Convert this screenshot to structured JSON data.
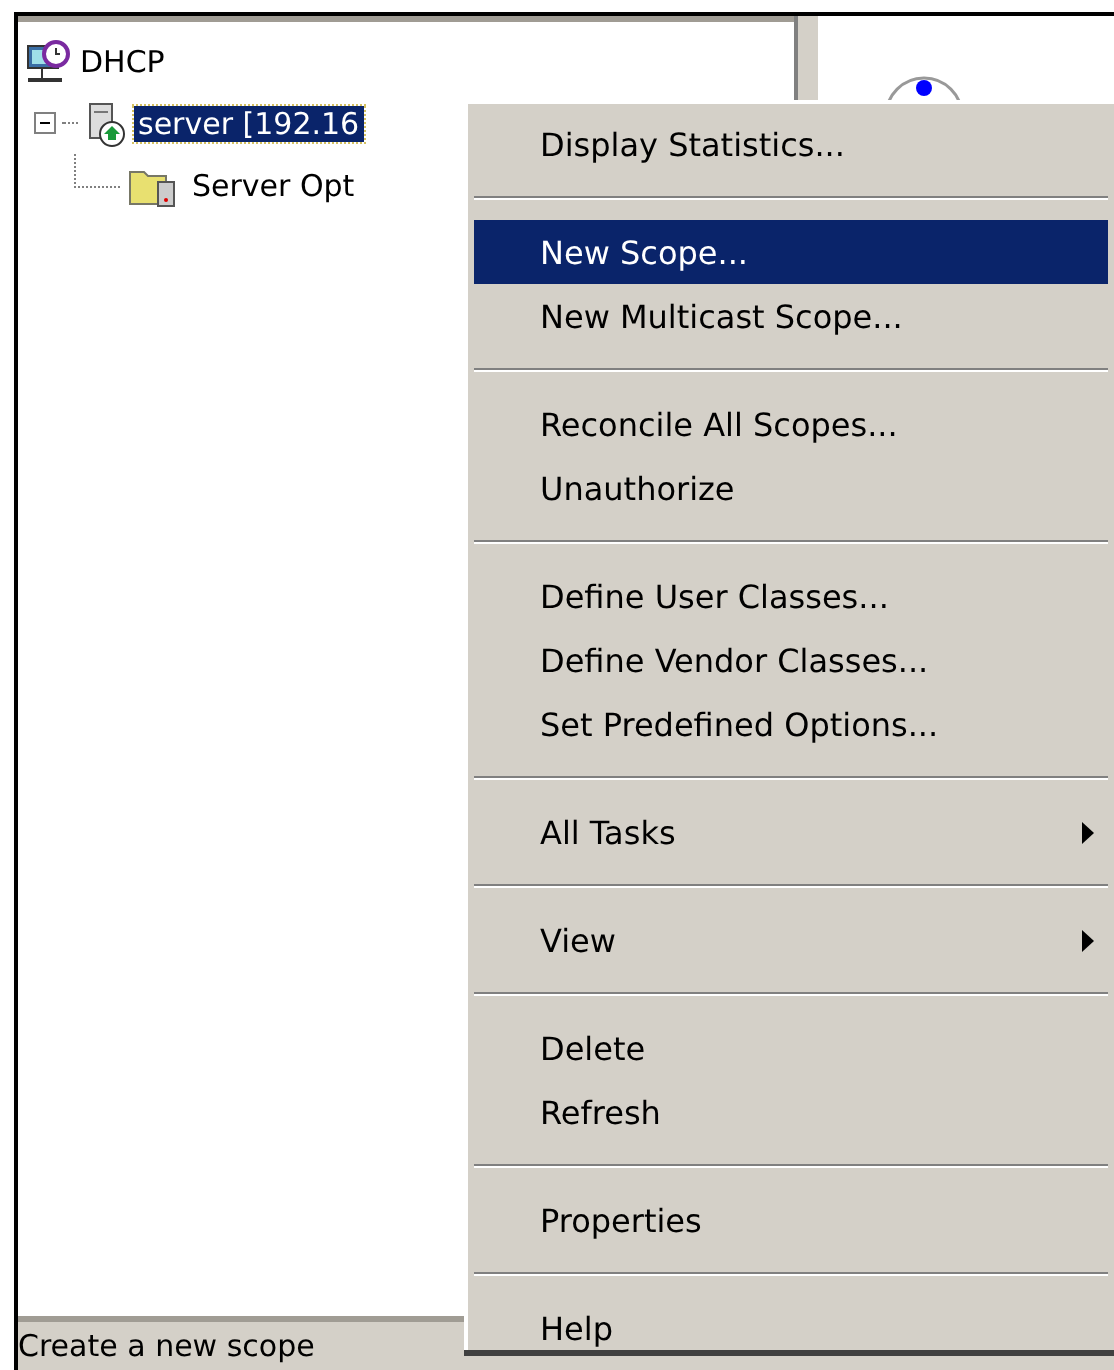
{
  "tree": [
    {
      "label": "DHCP",
      "kind": "root",
      "selected": false,
      "children": [
        {
          "label": "server [192.16",
          "kind": "server",
          "selected": true,
          "expanded": true,
          "children": [
            {
              "label": "Server Opt",
              "kind": "folder",
              "selected": false
            }
          ]
        }
      ]
    }
  ],
  "context_menu": [
    {
      "kind": "item",
      "label": "Display Statistics...",
      "selected": false,
      "submenu": false
    },
    {
      "kind": "separator"
    },
    {
      "kind": "item",
      "label": "New Scope...",
      "selected": true,
      "submenu": false
    },
    {
      "kind": "item",
      "label": "New Multicast Scope...",
      "selected": false,
      "submenu": false
    },
    {
      "kind": "separator"
    },
    {
      "kind": "item",
      "label": "Reconcile All Scopes...",
      "selected": false,
      "submenu": false
    },
    {
      "kind": "item",
      "label": "Unauthorize",
      "selected": false,
      "submenu": false
    },
    {
      "kind": "separator"
    },
    {
      "kind": "item",
      "label": "Define User Classes...",
      "selected": false,
      "submenu": false
    },
    {
      "kind": "item",
      "label": "Define Vendor Classes...",
      "selected": false,
      "submenu": false
    },
    {
      "kind": "item",
      "label": "Set Predefined Options...",
      "selected": false,
      "submenu": false
    },
    {
      "kind": "separator"
    },
    {
      "kind": "item",
      "label": "All Tasks",
      "selected": false,
      "submenu": true
    },
    {
      "kind": "separator"
    },
    {
      "kind": "item",
      "label": "View",
      "selected": false,
      "submenu": true
    },
    {
      "kind": "separator"
    },
    {
      "kind": "item",
      "label": "Delete",
      "selected": false,
      "submenu": false
    },
    {
      "kind": "item",
      "label": "Refresh",
      "selected": false,
      "submenu": false
    },
    {
      "kind": "separator"
    },
    {
      "kind": "item",
      "label": "Properties",
      "selected": false,
      "submenu": false
    },
    {
      "kind": "separator"
    },
    {
      "kind": "item",
      "label": "Help",
      "selected": false,
      "submenu": false
    }
  ],
  "status_bar": "Create a new scope"
}
